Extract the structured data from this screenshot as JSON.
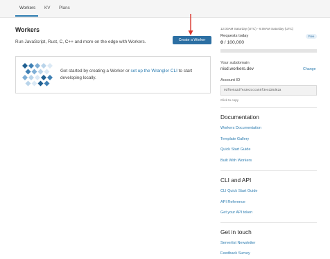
{
  "tabs": [
    {
      "label": "Workers"
    },
    {
      "label": "KV"
    },
    {
      "label": "Plans"
    }
  ],
  "main": {
    "title": "Workers",
    "subtitle": "Run JavaScript, Rust, C, C++ and more on the edge with Workers.",
    "create_button": "Create a Worker",
    "card": {
      "text_before": "Get started by creating a Worker or ",
      "link": "set up the Wrangler CLI",
      "text_after": " to start developing locally."
    }
  },
  "sidebar": {
    "reset_time": "12:00AM Saturday (UTC) - 6:08AM Saturday (UTC)",
    "requests_label": "Requests today",
    "plan_badge": "Free",
    "requests_used": "0",
    "requests_sep": "/",
    "requests_limit": "100,000",
    "requests_fraction": 0,
    "subdomain_label": "Your subdomain",
    "subdomain": "nisd.workers.dev",
    "change_link": "Change",
    "account_label": "Account ID",
    "account_id": "0df5e5a2dfea3e2ccca55f3e4d26d62a",
    "copy_hint": "Click to copy",
    "sections": [
      {
        "title": "Documentation",
        "links": [
          "Workers Documentation",
          "Template Gallery",
          "Quick Start Guide",
          "Built With Workers"
        ]
      },
      {
        "title": "CLI and API",
        "links": [
          "CLI Quick Start Guide",
          "API Reference",
          "Get your API token"
        ]
      },
      {
        "title": "Get in touch",
        "links": [
          "Serverlist Newsletter",
          "Feedback Survey"
        ]
      }
    ]
  },
  "colors": {
    "accent": "#2c6fa3",
    "link": "#2c7cb0",
    "arrow": "#d9342b"
  }
}
